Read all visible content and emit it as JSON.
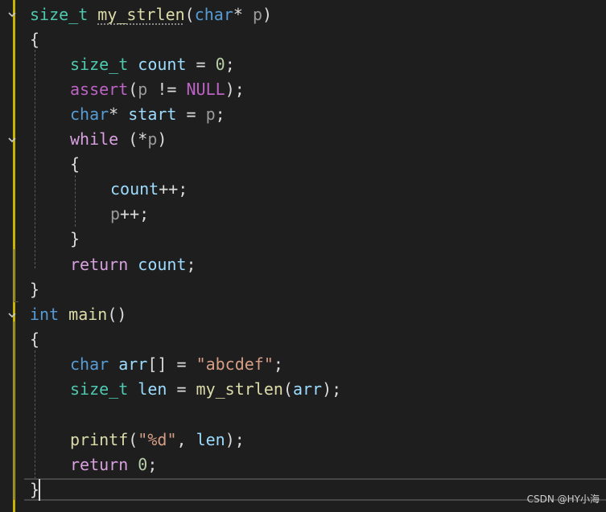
{
  "editor": {
    "language": "c",
    "lines": [
      {
        "tokens": [
          {
            "t": "type",
            "v": "size_t"
          },
          {
            "t": "",
            "v": " "
          },
          {
            "t": "fn",
            "v": "my_strlen"
          },
          {
            "t": "",
            "v": "("
          },
          {
            "t": "kw",
            "v": "char"
          },
          {
            "t": "",
            "v": "* "
          },
          {
            "t": "param",
            "v": "p"
          },
          {
            "t": "",
            "v": ")"
          }
        ]
      },
      {
        "tokens": [
          {
            "t": "",
            "v": "{"
          }
        ]
      },
      {
        "tokens": [
          {
            "t": "type",
            "v": "size_t"
          },
          {
            "t": "",
            "v": " "
          },
          {
            "t": "var",
            "v": "count"
          },
          {
            "t": "",
            "v": " = "
          },
          {
            "t": "num",
            "v": "0"
          },
          {
            "t": "",
            "v": ";"
          }
        ]
      },
      {
        "tokens": [
          {
            "t": "macro",
            "v": "assert"
          },
          {
            "t": "",
            "v": "("
          },
          {
            "t": "param",
            "v": "p"
          },
          {
            "t": "",
            "v": " != "
          },
          {
            "t": "macro",
            "v": "NULL"
          },
          {
            "t": "",
            "v": ");"
          }
        ]
      },
      {
        "tokens": [
          {
            "t": "kw",
            "v": "char"
          },
          {
            "t": "",
            "v": "* "
          },
          {
            "t": "var",
            "v": "start"
          },
          {
            "t": "",
            "v": " = "
          },
          {
            "t": "param",
            "v": "p"
          },
          {
            "t": "",
            "v": ";"
          }
        ]
      },
      {
        "tokens": [
          {
            "t": "ctl",
            "v": "while"
          },
          {
            "t": "",
            "v": " (*"
          },
          {
            "t": "param",
            "v": "p"
          },
          {
            "t": "",
            "v": ")"
          }
        ]
      },
      {
        "tokens": [
          {
            "t": "",
            "v": "{"
          }
        ]
      },
      {
        "tokens": [
          {
            "t": "var",
            "v": "count"
          },
          {
            "t": "",
            "v": "++;"
          }
        ]
      },
      {
        "tokens": [
          {
            "t": "param",
            "v": "p"
          },
          {
            "t": "",
            "v": "++;"
          }
        ]
      },
      {
        "tokens": [
          {
            "t": "",
            "v": "}"
          }
        ]
      },
      {
        "tokens": [
          {
            "t": "ctl",
            "v": "return"
          },
          {
            "t": "",
            "v": " "
          },
          {
            "t": "var",
            "v": "count"
          },
          {
            "t": "",
            "v": ";"
          }
        ]
      },
      {
        "tokens": [
          {
            "t": "",
            "v": "}"
          }
        ]
      },
      {
        "tokens": [
          {
            "t": "kw",
            "v": "int"
          },
          {
            "t": "",
            "v": " "
          },
          {
            "t": "fn",
            "v": "main"
          },
          {
            "t": "",
            "v": "()"
          }
        ]
      },
      {
        "tokens": [
          {
            "t": "",
            "v": "{"
          }
        ]
      },
      {
        "tokens": [
          {
            "t": "kw",
            "v": "char"
          },
          {
            "t": "",
            "v": " "
          },
          {
            "t": "var",
            "v": "arr"
          },
          {
            "t": "",
            "v": "[] = "
          },
          {
            "t": "str",
            "v": "\"abcdef\""
          },
          {
            "t": "",
            "v": ";"
          }
        ]
      },
      {
        "tokens": [
          {
            "t": "type",
            "v": "size_t"
          },
          {
            "t": "",
            "v": " "
          },
          {
            "t": "var",
            "v": "len"
          },
          {
            "t": "",
            "v": " = "
          },
          {
            "t": "fn",
            "v": "my_strlen"
          },
          {
            "t": "",
            "v": "("
          },
          {
            "t": "var",
            "v": "arr"
          },
          {
            "t": "",
            "v": ");"
          }
        ]
      },
      {
        "tokens": []
      },
      {
        "tokens": [
          {
            "t": "fn",
            "v": "printf"
          },
          {
            "t": "",
            "v": "("
          },
          {
            "t": "str",
            "v": "\""
          },
          {
            "t": "fmt",
            "v": "%d"
          },
          {
            "t": "str",
            "v": "\""
          },
          {
            "t": "",
            "v": ", "
          },
          {
            "t": "var",
            "v": "len"
          },
          {
            "t": "",
            "v": ");"
          }
        ]
      },
      {
        "tokens": [
          {
            "t": "ctl",
            "v": "return"
          },
          {
            "t": "",
            "v": " "
          },
          {
            "t": "num",
            "v": "0"
          },
          {
            "t": "",
            "v": ";"
          }
        ]
      },
      {
        "tokens": [
          {
            "t": "",
            "v": "}"
          }
        ]
      }
    ]
  },
  "fold_markers": [
    "chevron-down-icon",
    "chevron-down-icon",
    "chevron-down-icon"
  ],
  "colors": {
    "background": "#1e1e1e",
    "change_bar": "#c8b400",
    "keyword": "#569cd6",
    "control": "#d8a0df",
    "type": "#4ec9b0",
    "function": "#dcdcaa",
    "variable": "#9cdcfe",
    "string": "#d69d85",
    "number": "#b5cea8"
  },
  "watermark": "CSDN @HY小海"
}
